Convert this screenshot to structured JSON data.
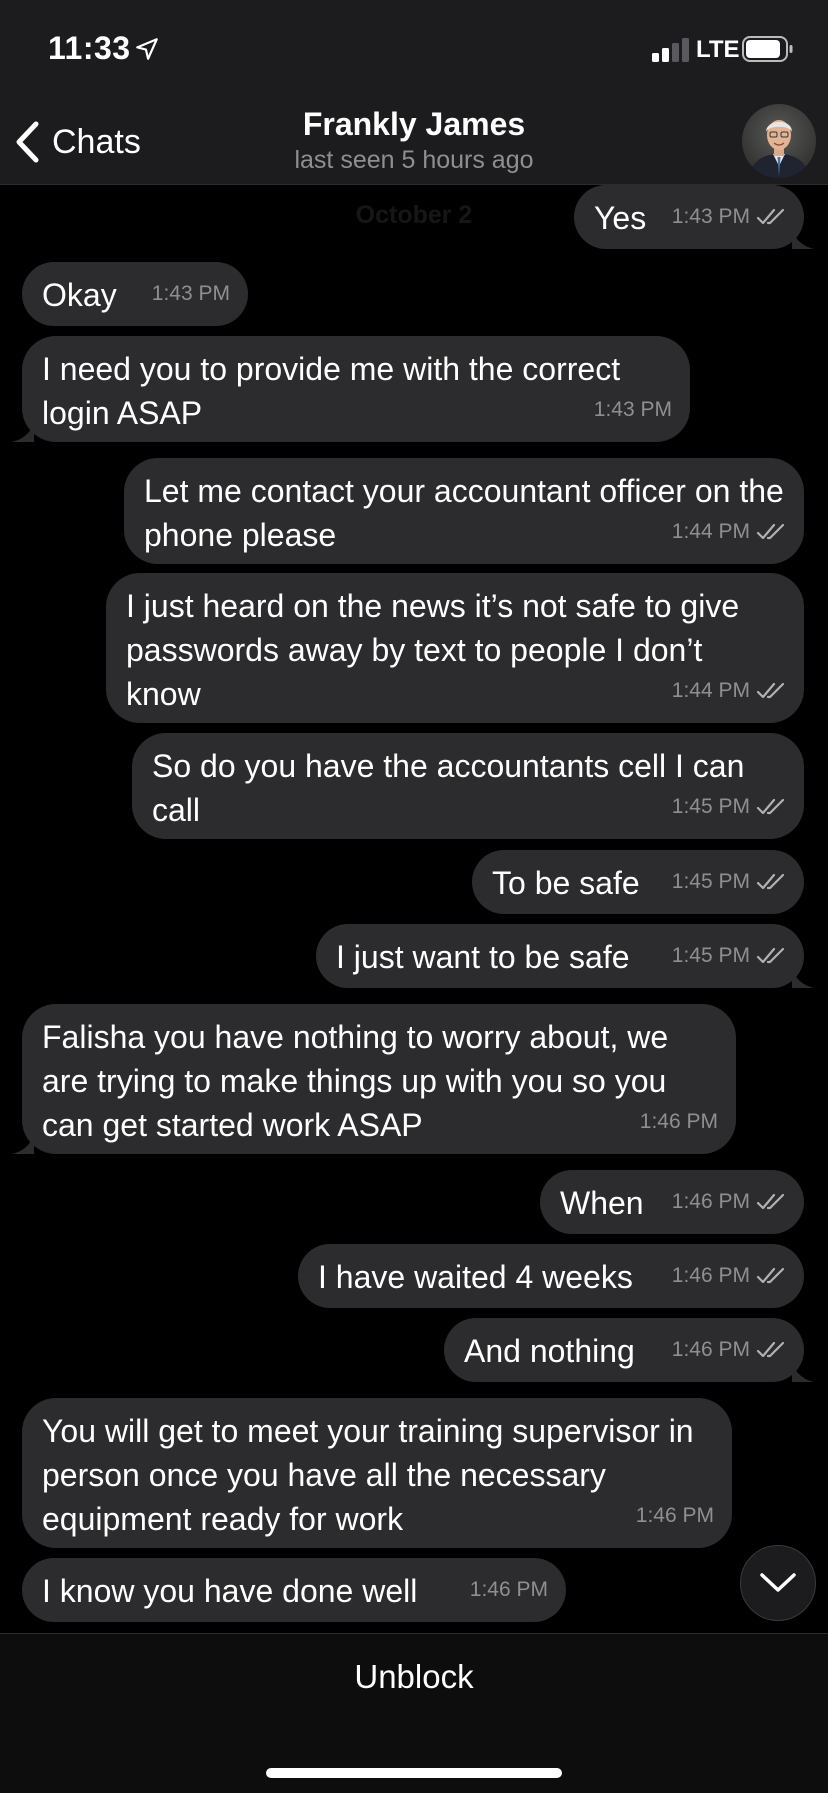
{
  "status_bar": {
    "time": "11:33",
    "network": "LTE",
    "icons": [
      "location-arrow-icon",
      "signal-icon",
      "battery-icon"
    ]
  },
  "header": {
    "back_label": "Chats",
    "contact_name": "Frankly James",
    "last_seen": "last seen 5 hours ago",
    "avatar_icon": "contact-avatar"
  },
  "chat": {
    "date_label": "October 2",
    "messages": [
      {
        "dir": "out",
        "text": "Yes",
        "time": "1:43 PM",
        "read": true
      },
      {
        "dir": "in",
        "text": "Okay",
        "time": "1:43 PM"
      },
      {
        "dir": "in",
        "text": "I need you to provide me with the correct login ASAP",
        "time": "1:43 PM"
      },
      {
        "dir": "out",
        "text": "Let me contact your accountant officer on the phone please",
        "time": "1:44 PM",
        "read": true
      },
      {
        "dir": "out",
        "text": "I just heard on the news it’s not safe to give passwords away by text to people I don’t know",
        "time": "1:44 PM",
        "read": true
      },
      {
        "dir": "out",
        "text": "So do you have the accountants cell I can call",
        "time": "1:45 PM",
        "read": true
      },
      {
        "dir": "out",
        "text": "To be safe",
        "time": "1:45 PM",
        "read": true
      },
      {
        "dir": "out",
        "text": "I just want to be safe",
        "time": "1:45 PM",
        "read": true
      },
      {
        "dir": "in",
        "text": "Falisha you have nothing to worry about, we are trying to make things up with you so you can get started work ASAP",
        "time": "1:46 PM"
      },
      {
        "dir": "out",
        "text": "When",
        "time": "1:46 PM",
        "read": true
      },
      {
        "dir": "out",
        "text": "I have waited 4 weeks",
        "time": "1:46 PM",
        "read": true
      },
      {
        "dir": "out",
        "text": "And nothing",
        "time": "1:46 PM",
        "read": true
      },
      {
        "dir": "in",
        "text": "You will get to meet your training supervisor in person once you have all the necessary equipment ready for work",
        "time": "1:46 PM"
      },
      {
        "dir": "in",
        "text": "I know you have done well",
        "time": "1:46 PM"
      }
    ]
  },
  "scroll_down_icon": "chevron-down-icon",
  "bottom": {
    "unblock_label": "Unblock"
  },
  "colors": {
    "background": "#000000",
    "bubble": "#2c2c2e",
    "secondary_text": "#8e8e93",
    "bar": "#1c1c1e"
  }
}
